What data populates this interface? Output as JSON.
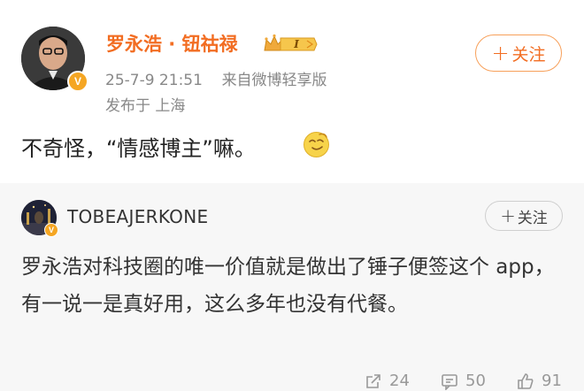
{
  "post": {
    "author": "罗永浩 · 钮祜禄",
    "timestamp": "25-7-9 21:51",
    "source": "来自微博轻享版",
    "location": "发布于 上海",
    "follow_label": "关注",
    "content": "不奇怪，“情感博主”嘛。",
    "verified_badge": "V",
    "member_icon": "crown-member-badge",
    "emoji_icon": "doge-emoji"
  },
  "comment": {
    "author": "TOBEAJERKONE",
    "follow_label": "关注",
    "text": "罗永浩对科技圈的唯一价值就是做出了锤子便签这个 app，有一说一是真好用，这么多年也没有代餐。",
    "verified_badge": "V"
  },
  "actions": {
    "repost_count": "24",
    "comment_count": "50",
    "like_count": "91"
  },
  "colors": {
    "accent": "#f26d22",
    "muted": "#888888",
    "comment_bg": "#f7f7f7"
  }
}
